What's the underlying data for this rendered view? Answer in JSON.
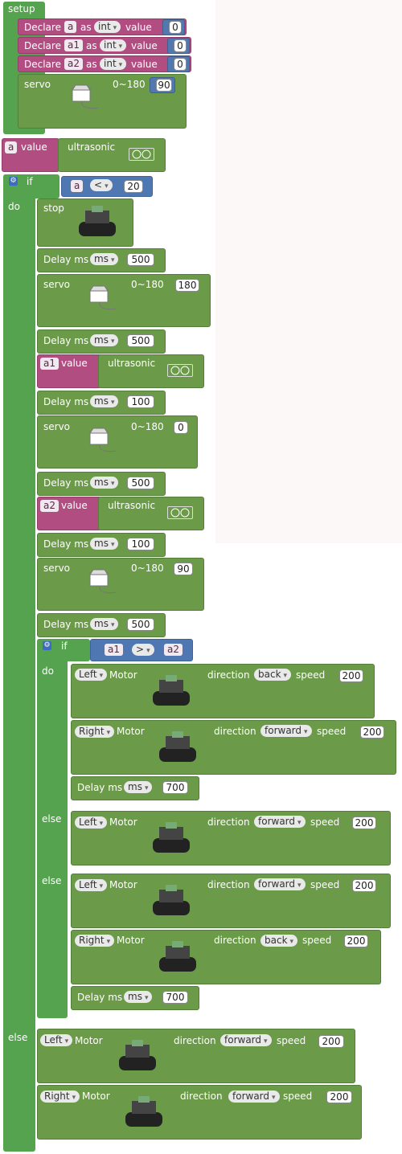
{
  "labels": {
    "setup": "setup",
    "declare": "Declare",
    "as": "as",
    "type_int": "int",
    "value": "value",
    "servo": "servo",
    "range": "0~180",
    "ultrasonic": "ultrasonic",
    "if": "if",
    "do": "do",
    "else": "else",
    "stop": "stop",
    "delay": "Delay ms",
    "ms": "ms",
    "motor": "Motor",
    "direction": "direction",
    "speed": "speed",
    "lt": "<",
    "gt": ">"
  },
  "vars": {
    "a": "a",
    "a1": "a1",
    "a2": "a2"
  },
  "declares": [
    {
      "var": "a",
      "value": "0"
    },
    {
      "var": "a1",
      "value": "0"
    },
    {
      "var": "a2",
      "value": "0"
    }
  ],
  "setup_servo": "90",
  "if_threshold": "20",
  "delays": [
    "500",
    "500",
    "100",
    "500",
    "100",
    "500",
    "700",
    "700"
  ],
  "servos": [
    "180",
    "0",
    "90"
  ],
  "motors": [
    {
      "side": "Left",
      "dir": "back",
      "speed": "200"
    },
    {
      "side": "Right",
      "dir": "forward",
      "speed": "200"
    },
    {
      "side": "Left",
      "dir": "forward",
      "speed": "200"
    },
    {
      "side": "Left",
      "dir": "forward",
      "speed": "200"
    },
    {
      "side": "Right",
      "dir": "back",
      "speed": "200"
    },
    {
      "side": "Left",
      "dir": "forward",
      "speed": "200"
    },
    {
      "side": "Right",
      "dir": "forward",
      "speed": "200"
    }
  ],
  "icons": {
    "gear": "gear-icon",
    "servo": "servo-icon",
    "car": "robot-car-icon",
    "sensor": "ultrasonic-sensor-icon"
  }
}
